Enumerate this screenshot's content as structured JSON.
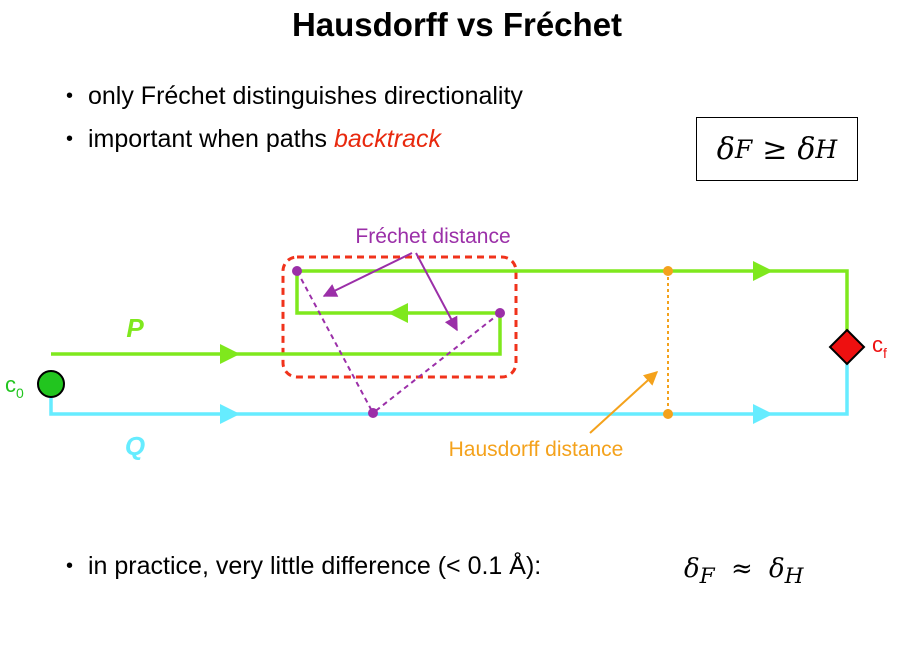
{
  "title": "Hausdorff vs Fréchet",
  "bullets": [
    {
      "text": "only Fréchet distinguishes directionality"
    },
    {
      "text_before": "important when paths ",
      "emphasis": "backtrack"
    },
    {
      "text": "in practice, very little difference (< 0.1 Å):"
    }
  ],
  "formula_box": {
    "delta": "δ",
    "sub_f": "F",
    "relation": "≥",
    "sub_h": "H"
  },
  "inline_formula": {
    "delta": "δ",
    "sub_f": "F",
    "relation": "≈",
    "sub_h": "H"
  },
  "diagram": {
    "labels": {
      "path_p": "P",
      "path_q": "Q",
      "start": "c",
      "start_sub": "0",
      "end": "c",
      "end_sub": "f",
      "frechet": "Fréchet distance",
      "hausdorff": "Hausdorff distance"
    },
    "colors": {
      "path_p": "#7fe81d",
      "path_q": "#66ecff",
      "frechet": "#9b2fa8",
      "hausdorff": "#f4a21c",
      "highlight_box": "#f0321b",
      "end_marker": "#ee1010",
      "start_marker": "#22c51f"
    }
  }
}
